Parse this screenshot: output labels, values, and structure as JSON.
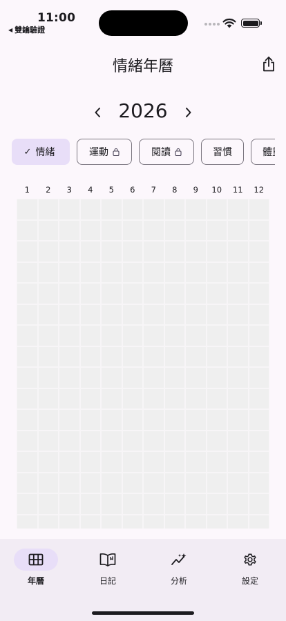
{
  "status_bar": {
    "time": "11:00",
    "back_app": "雙鑰驗證"
  },
  "header": {
    "title": "情緒年曆",
    "share_icon": "share-icon"
  },
  "year_selector": {
    "year": "2026",
    "prev_icon": "chevron-left-icon",
    "next_icon": "chevron-right-icon"
  },
  "chips": [
    {
      "label": "情緒",
      "selected": true,
      "locked": false
    },
    {
      "label": "運動",
      "selected": false,
      "locked": true
    },
    {
      "label": "閱讀",
      "selected": false,
      "locked": true
    },
    {
      "label": "習慣",
      "selected": false,
      "locked": false
    },
    {
      "label": "體重",
      "selected": false,
      "locked": false
    }
  ],
  "months": [
    "1",
    "2",
    "3",
    "4",
    "5",
    "6",
    "7",
    "8",
    "9",
    "10",
    "11",
    "12"
  ],
  "nav": {
    "items": [
      {
        "label": "年曆",
        "icon": "calendar-grid-icon",
        "active": true
      },
      {
        "label": "日記",
        "icon": "book-icon",
        "active": false
      },
      {
        "label": "分析",
        "icon": "analytics-icon",
        "active": false
      },
      {
        "label": "設定",
        "icon": "gear-icon",
        "active": false
      }
    ]
  },
  "colors": {
    "background": "#fcf7fc",
    "accent": "#e8def8",
    "cell": "#efefef",
    "nav_background": "#f2ecf4"
  }
}
